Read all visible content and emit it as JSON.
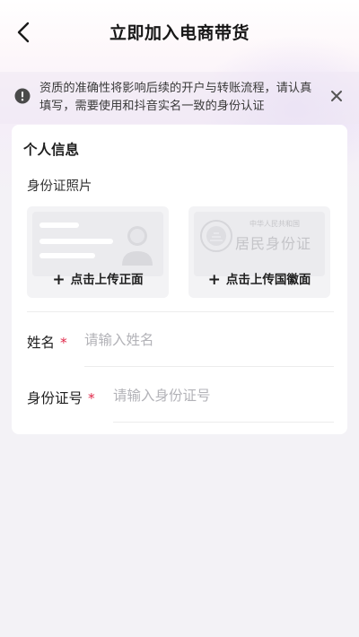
{
  "header": {
    "title": "立即加入电商带货",
    "back_icon": "chevron-left-icon"
  },
  "notice": {
    "text": "资质的准确性将影响后续的开户与转账流程，请认真填写，需要使用和抖音实名一致的身份认证",
    "icon": "info-circle-icon",
    "close_icon": "close-icon"
  },
  "personal_info": {
    "section_title": "个人信息",
    "id_photo_label": "身份证照片",
    "upload_front": {
      "label": "点击上传正面"
    },
    "upload_back": {
      "label": "点击上传国徽面",
      "card_header": "中华人民共和国",
      "card_title": "居民身份证"
    },
    "name_field": {
      "label": "姓名",
      "required_mark": "*",
      "placeholder": "请输入姓名",
      "value": ""
    },
    "id_field": {
      "label": "身份证号",
      "required_mark": "*",
      "placeholder": "请输入身份证号",
      "value": ""
    }
  },
  "colors": {
    "required": "#e0294a",
    "placeholder": "#b3b3b8",
    "background": "#f3f2f6"
  }
}
